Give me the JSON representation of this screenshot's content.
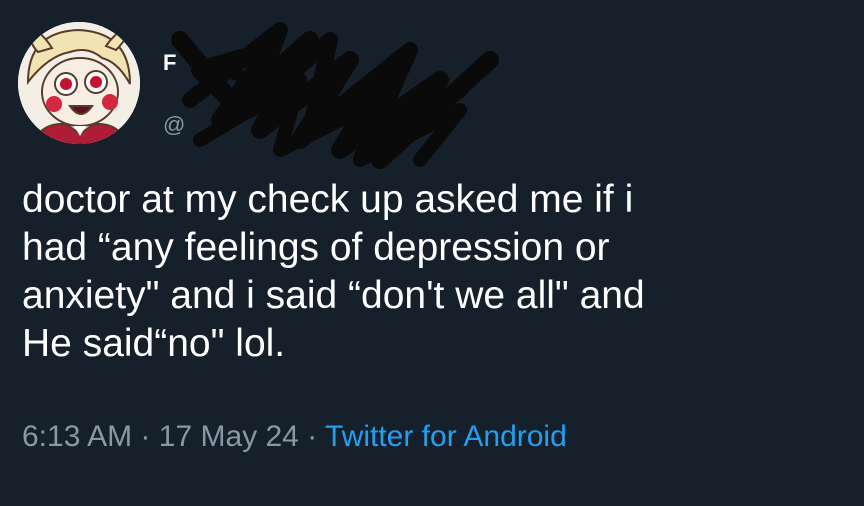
{
  "tweet": {
    "display_name": "F",
    "handle": "@",
    "text": "doctor at my check up asked me if i\nhad “any feelings of depression or\nanxiety\" and i said “don't we all\" and\nHe said“no\" lol.",
    "time": "6:13 AM",
    "separator": "·",
    "date": "17 May 24",
    "source": "Twitter for Android"
  },
  "avatar": {
    "icon": "cartoon-character-avatar",
    "colors": {
      "background": "#f3efe6",
      "hair": "#f2e3b3",
      "skin": "#f7efe4",
      "cheeks": "#d7263d",
      "eyes": "#c8102e",
      "jacket": "#b01c36"
    }
  },
  "colors": {
    "background": "#15202b",
    "primary_text": "#ffffff",
    "secondary_text": "#8899a6",
    "link": "#1da1f2",
    "redaction": "#0a0a0a"
  }
}
